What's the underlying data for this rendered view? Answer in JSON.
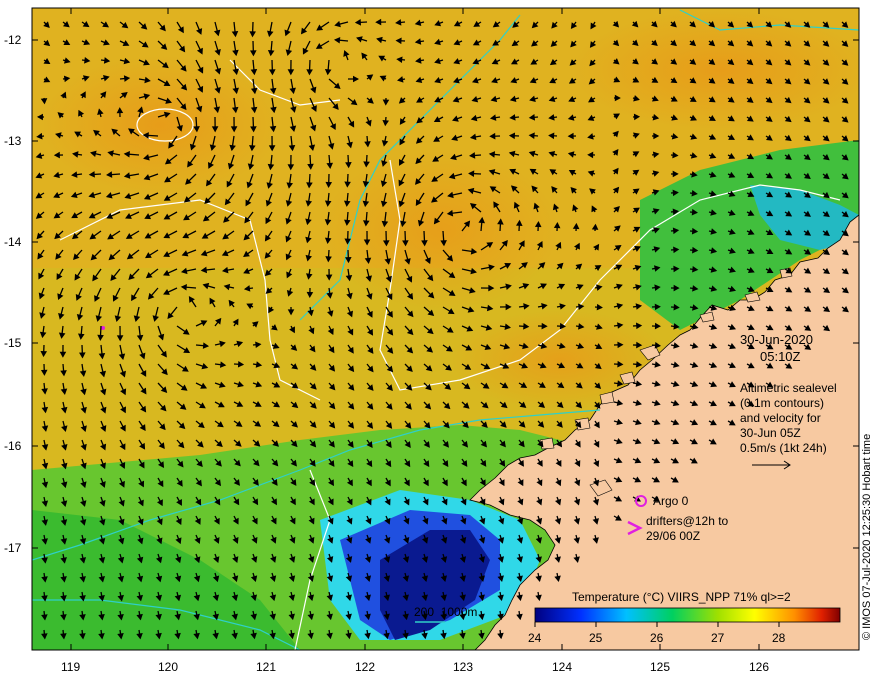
{
  "map": {
    "lat_ticks": [
      "-12",
      "-13",
      "-14",
      "-15",
      "-16",
      "-17"
    ],
    "lon_ticks": [
      "119",
      "120",
      "121",
      "122",
      "123",
      "124",
      "125",
      "126"
    ],
    "date": "30-Jun-2020",
    "time": "05:10Z",
    "desc_lines": [
      "Altimetric sealevel",
      "(0.1m contours)",
      "and velocity for",
      "30-Jun 05Z",
      "0.5m/s (1kt 24h)"
    ],
    "argo_label": "Argo 0",
    "drifter_lines": [
      "drifters@12h to",
      "29/06 00Z"
    ],
    "depth_legend": "200  1000m",
    "colorbar_title": "Temperature (°C) VIIRS_NPP 71% ql>=2",
    "colorbar_ticks": [
      "24",
      "25",
      "26",
      "27",
      "28"
    ],
    "credit": "© IMOS 07-Jul-2020 12:25:30 Hobart time",
    "colors": {
      "land": "#f7c9a1",
      "warm": "#e8a019",
      "mid": "#c8c21a",
      "cool": "#3dbd3d",
      "cold": "#0a2aa8",
      "arrow": "#000000",
      "contour": "#ffffff",
      "isobath": "#2fd0c8",
      "argo": "#e020e0"
    }
  }
}
